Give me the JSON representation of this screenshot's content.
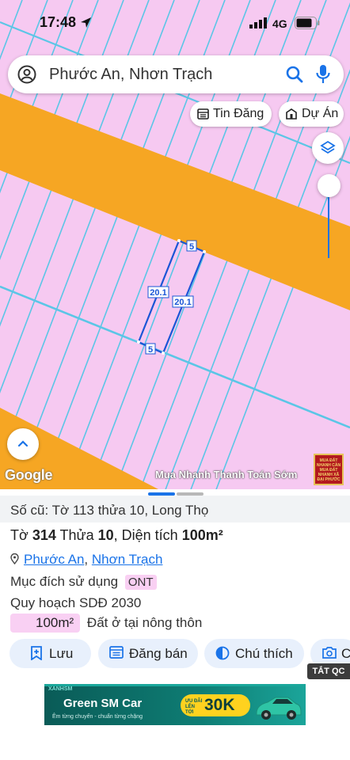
{
  "status": {
    "time": "17:48",
    "network": "4G"
  },
  "search": {
    "query": "Phước An, Nhơn Trạch"
  },
  "chips": {
    "listings": "Tin Đăng",
    "projects": "Dự Án"
  },
  "map": {
    "google_label": "Google",
    "ad_text": "Mua Nhanh Thanh Toán Sớm",
    "ad_thumb_text": "MUA ĐẤT NHANH CẦN MUA ĐẤT NHANH XÃ ĐẠI PHƯỚC",
    "parcel": {
      "side_top": "5",
      "side_bottom": "5",
      "side_left": "20.1",
      "side_right": "20.1"
    },
    "colors": {
      "land": "#f6c9f1",
      "road": "#f6a623",
      "lines": "#5bc6e6",
      "parcel_outline": "#1a56d6"
    }
  },
  "info": {
    "old_record": "Số cũ: Tờ 113 thửa 10, Long Thọ",
    "sheet_prefix": "Tờ ",
    "sheet_no": "314",
    "parcel_prefix": " Thửa ",
    "parcel_no": "10",
    "area_prefix": ", Diện tích ",
    "area": "100m²",
    "ward": "Phước An",
    "separator": ", ",
    "district": "Nhơn Trạch",
    "usage_label": "Mục đích sử dụng",
    "usage_code": "ONT",
    "plan_label": "Quy hoạch SDĐ 2030",
    "plan_area": "100m²",
    "plan_desc": "Đất ở tại nông thôn"
  },
  "actions": {
    "save": "Lưu",
    "post": "Đăng bán",
    "legend": "Chú thích",
    "capture": "C"
  },
  "ad": {
    "close_label": "TẮT QC",
    "brand": "XANHSM",
    "title": "Green SM Car",
    "subtitle": "Êm từng chuyến - chuẩn từng chặng",
    "promo_small": "ƯU ĐÃI LÊN TỚI",
    "promo_value": "30K"
  }
}
